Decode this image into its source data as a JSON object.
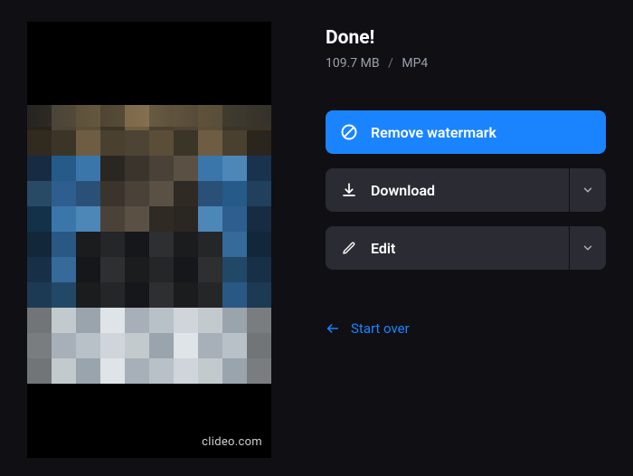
{
  "preview": {
    "watermark": "clideo.com"
  },
  "status": {
    "title": "Done!",
    "size": "109.7 MB",
    "format": "MP4"
  },
  "actions": {
    "remove_watermark": "Remove watermark",
    "download": "Download",
    "edit": "Edit"
  },
  "links": {
    "start_over": "Start over"
  },
  "colors": {
    "accent": "#1a84ff",
    "panel": "#2b2b33",
    "bg": "#0f0f14"
  }
}
